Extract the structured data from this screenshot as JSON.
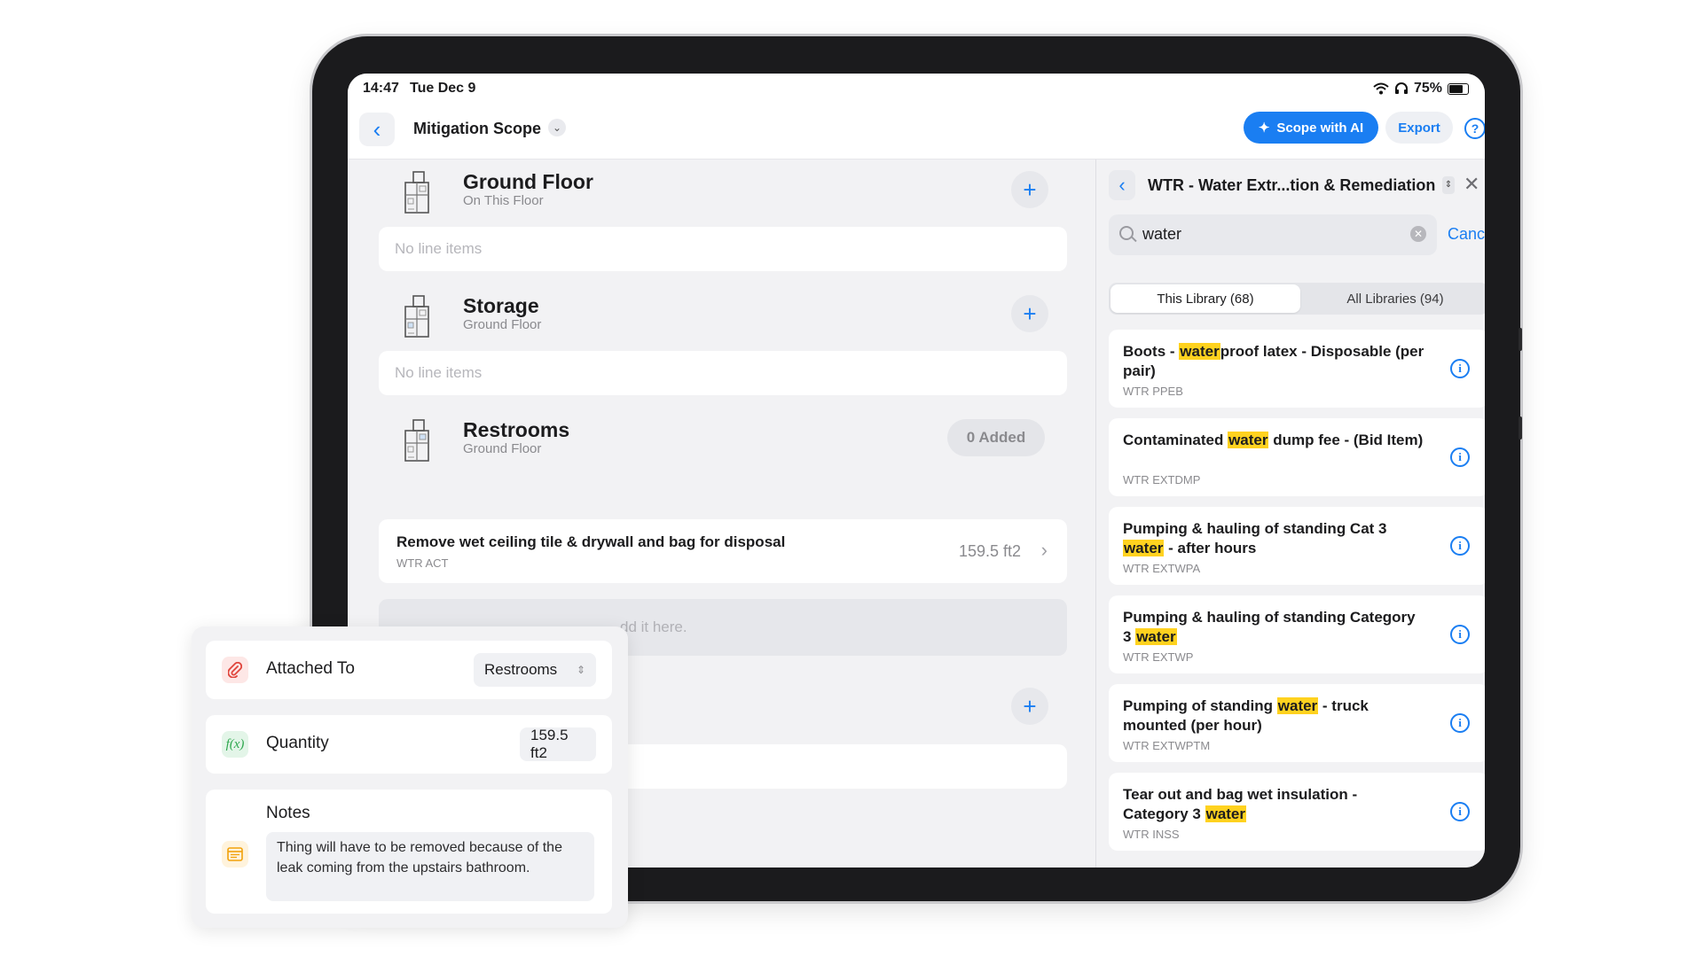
{
  "status_bar": {
    "time": "14:47",
    "date": "Tue Dec 9",
    "battery": "75%"
  },
  "nav": {
    "title": "Mitigation Scope",
    "scope_ai_label": "Scope with AI",
    "export_label": "Export"
  },
  "rooms": [
    {
      "title": "Ground Floor",
      "subtitle": "On This Floor",
      "empty_text": "No line items"
    },
    {
      "title": "Storage",
      "subtitle": "Ground Floor",
      "empty_text": "No line items"
    },
    {
      "title": "Restrooms",
      "subtitle": "Ground Floor",
      "added_label": "0 Added",
      "line_item": {
        "title": "Remove wet ceiling tile & drywall and bag for disposal",
        "code": "WTR ACT",
        "quantity": "159.5 ft2"
      },
      "drop_hint": "dd it here."
    }
  ],
  "panel": {
    "title": "WTR - Water Extr...tion & Remediation",
    "search_value": "water",
    "cancel_label": "Cancel",
    "tabs": [
      "This Library (68)",
      "All Libraries (94)"
    ],
    "results": [
      {
        "before": "Boots - ",
        "match": "water",
        "after": "proof latex - Disposable (per pair)",
        "code": "WTR PPEB"
      },
      {
        "before": "Contaminated ",
        "match": "water",
        "after": " dump fee - (Bid Item)",
        "code": "WTR EXTDMP"
      },
      {
        "before": "Pumping & hauling of standing Cat 3 ",
        "match": "water",
        "after": " - after hours",
        "code": "WTR EXTWPA"
      },
      {
        "before": "Pumping & hauling of standing Category 3 ",
        "match": "water",
        "after": "",
        "code": "WTR EXTWP"
      },
      {
        "before": "Pumping of standing ",
        "match": "water",
        "after": " - truck mounted (per hour)",
        "code": "WTR EXTWPTM"
      },
      {
        "before": "Tear out and bag wet insulation - Category 3 ",
        "match": "water",
        "after": "",
        "code": "WTR INSS"
      }
    ]
  },
  "detail": {
    "attached_label": "Attached To",
    "attached_value": "Restrooms",
    "quantity_label": "Quantity",
    "quantity_icon_text": "f(x)",
    "quantity_value": "159.5 ft2",
    "notes_label": "Notes",
    "notes_text": "Thing will have to be removed because of the leak coming from the upstairs bathroom."
  },
  "colors": {
    "accent": "#1a7ef2",
    "highlight": "#ffd21f",
    "attach_icon": "#e0453c",
    "fx_icon": "#2fa84f",
    "notes_icon": "#f2a20c"
  },
  "icons": {
    "back": "chevron-left-icon",
    "help": "question-circle-icon",
    "sparkle": "sparkle-icon",
    "plus": "plus-icon",
    "info": "info-icon",
    "search": "search-icon",
    "clear": "clear-icon",
    "close": "close-icon",
    "attach": "paperclip-icon",
    "formula": "function-icon",
    "notes": "notes-icon",
    "floorplan": "floor-plan-icon"
  }
}
